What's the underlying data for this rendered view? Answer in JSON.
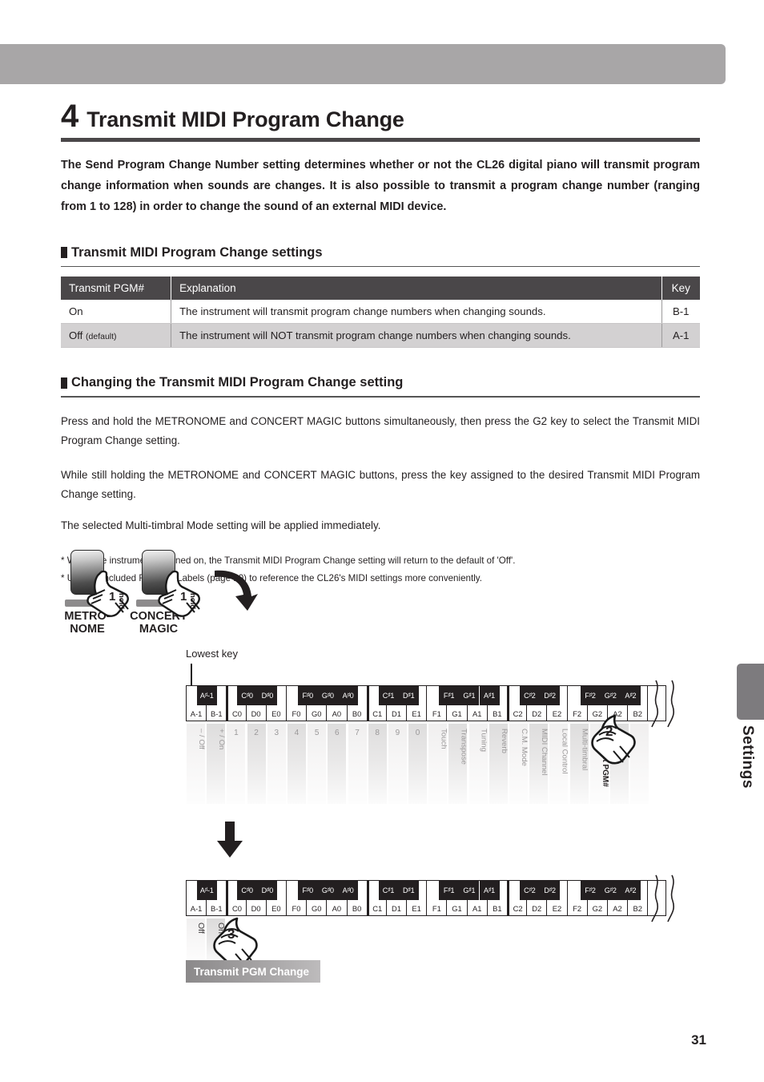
{
  "page": {
    "number": "31",
    "side_tab_label": "Settings"
  },
  "title": {
    "number": "4",
    "text": "Transmit MIDI Program Change"
  },
  "intro": "The Send Program Change Number setting determines whether or not the CL26 digital piano will transmit program change information when sounds are changes.  It is also possible to transmit a program change number (ranging from 1 to 128) in order to change the sound of an external MIDI device.",
  "section_settings": {
    "heading": "Transmit MIDI Program Change settings",
    "columns": [
      "Transmit PGM#",
      "Explanation",
      "Key"
    ],
    "rows": [
      {
        "setting": "On",
        "default_note": "",
        "explanation": "The instrument will transmit program change numbers when changing sounds.",
        "key": "B-1"
      },
      {
        "setting": "Off",
        "default_note": "(default)",
        "explanation": "The instrument will NOT transmit program change numbers when changing sounds.",
        "key": "A-1"
      }
    ]
  },
  "section_changing": {
    "heading": "Changing the Transmit MIDI Program Change setting",
    "para1": "Press and hold the METRONOME and CONCERT MAGIC buttons simultaneously, then press the G2 key to select the Transmit MIDI Program Change setting.",
    "para2": "While still holding the METRONOME and CONCERT MAGIC buttons, press the key assigned to the desired Transmit MIDI Program Change setting.",
    "para3": "The selected Multi-timbral Mode setting will be applied immediately.",
    "notes": [
      "* When the instrument is turned on, the Transmit MIDI Program Change setting will return to the default of 'Off'.",
      "* Use the included Function Labels (page 10) to reference the CL26's MIDI settings more conveniently."
    ]
  },
  "buttons": {
    "metronome": {
      "line1": "METRO-",
      "line2": "NOME",
      "step": "1",
      "hold": "hold"
    },
    "concert_magic": {
      "line1": "CONCERT",
      "line2": "MAGIC",
      "step": "1",
      "hold": "hold"
    }
  },
  "keyboard": {
    "lowest_key_label": "Lowest key",
    "white_keys": [
      "A-1",
      "B-1",
      "C0",
      "D0",
      "E0",
      "F0",
      "G0",
      "A0",
      "B0",
      "C1",
      "D1",
      "E1",
      "F1",
      "G1",
      "A1",
      "B1",
      "C2",
      "D2",
      "E2",
      "F2",
      "G2",
      "A2",
      "B2"
    ],
    "black_keys": [
      {
        "label": "A#-1",
        "after": 0
      },
      {
        "label": "C#0",
        "after": 2
      },
      {
        "label": "D#0",
        "after": 3
      },
      {
        "label": "F#0",
        "after": 5
      },
      {
        "label": "G#0",
        "after": 6
      },
      {
        "label": "A#0",
        "after": 7
      },
      {
        "label": "C#1",
        "after": 9
      },
      {
        "label": "D#1",
        "after": 10
      },
      {
        "label": "F#1",
        "after": 12
      },
      {
        "label": "G#1",
        "after": 13
      },
      {
        "label": "A#1",
        "after": 14
      },
      {
        "label": "C#2",
        "after": 16
      },
      {
        "label": "D#2",
        "after": 17
      },
      {
        "label": "F#2",
        "after": 19
      },
      {
        "label": "G#2",
        "after": 20
      },
      {
        "label": "A#2",
        "after": 21
      }
    ],
    "octave_starts": [
      2,
      9,
      16
    ],
    "function_labels": [
      {
        "key": "A-1",
        "label": "– / Off",
        "vertical": true,
        "active": false
      },
      {
        "key": "B-1",
        "label": "+ / On",
        "vertical": true,
        "active": false
      },
      {
        "key": "C0",
        "label": "1",
        "vertical": false,
        "active": false
      },
      {
        "key": "D0",
        "label": "2",
        "vertical": false,
        "active": false
      },
      {
        "key": "E0",
        "label": "3",
        "vertical": false,
        "active": false
      },
      {
        "key": "F0",
        "label": "4",
        "vertical": false,
        "active": false
      },
      {
        "key": "G0",
        "label": "5",
        "vertical": false,
        "active": false
      },
      {
        "key": "A0",
        "label": "6",
        "vertical": false,
        "active": false
      },
      {
        "key": "B0",
        "label": "7",
        "vertical": false,
        "active": false
      },
      {
        "key": "C1",
        "label": "8",
        "vertical": false,
        "active": false
      },
      {
        "key": "D1",
        "label": "9",
        "vertical": false,
        "active": false
      },
      {
        "key": "E1",
        "label": "0",
        "vertical": false,
        "active": false
      },
      {
        "key": "F1",
        "label": "Touch",
        "vertical": true,
        "active": false
      },
      {
        "key": "G1",
        "label": "Transpose",
        "vertical": true,
        "active": false
      },
      {
        "key": "A1",
        "label": "Tuning",
        "vertical": true,
        "active": false
      },
      {
        "key": "B1",
        "label": "Reverb",
        "vertical": true,
        "active": false
      },
      {
        "key": "C2",
        "label": "C.M. Mode",
        "vertical": true,
        "active": false
      },
      {
        "key": "D2",
        "label": "MIDI Channel",
        "vertical": true,
        "active": false
      },
      {
        "key": "E2",
        "label": "Local Control",
        "vertical": true,
        "active": false
      },
      {
        "key": "F2",
        "label": "Multi-timbral",
        "vertical": true,
        "active": false
      },
      {
        "key": "G2",
        "label": "Transmit PGM#",
        "vertical": true,
        "active": true
      },
      {
        "key": "A2",
        "label": "",
        "vertical": true,
        "active": false
      },
      {
        "key": "B2",
        "label": "",
        "vertical": true,
        "active": false
      }
    ],
    "upper_pointer": {
      "step": "2",
      "target_key": "G2"
    },
    "lower_pointer": {
      "step": "3",
      "target_key": "B-1"
    },
    "value_labels": [
      {
        "key": "A-1",
        "label": "Off"
      },
      {
        "key": "B-1",
        "label": "On"
      }
    ],
    "banner_label": "Transmit PGM Change"
  }
}
